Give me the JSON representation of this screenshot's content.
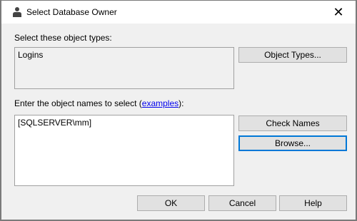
{
  "window": {
    "title": "Select Database Owner"
  },
  "object_types": {
    "label": "Select these object types:",
    "value": "Logins",
    "button": "Object Types..."
  },
  "object_names": {
    "label_prefix": "Enter the object names to select (",
    "link": "examples",
    "label_suffix": "):",
    "value": "[SQLSERVER\\mm]"
  },
  "buttons": {
    "check_names": "Check Names",
    "browse": "Browse...",
    "ok": "OK",
    "cancel": "Cancel",
    "help": "Help"
  }
}
